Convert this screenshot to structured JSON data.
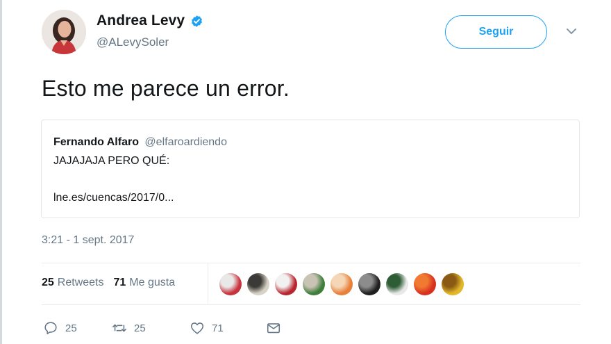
{
  "author": {
    "name": "Andrea Levy",
    "handle": "@ALevySoler",
    "verified": true
  },
  "follow_button": {
    "label": "Seguir"
  },
  "tweet": {
    "text": "Esto me parece un error.",
    "timestamp": "3:21 - 1 sept. 2017"
  },
  "quoted_tweet": {
    "name": "Fernando Alfaro",
    "handle": "@elfaroardiendo",
    "text": "JAJAJAJA PERO QUÉ:",
    "link": "lne.es/cuencas/2017/0..."
  },
  "stats": {
    "retweets_count": "25",
    "retweets_label": "Retweets",
    "likes_count": "71",
    "likes_label": "Me gusta"
  },
  "actions": {
    "reply_count": "25",
    "retweet_count": "25",
    "like_count": "71"
  },
  "colors": {
    "accent": "#1da1f2",
    "secondary_text": "#657786",
    "border": "#e1e8ed"
  },
  "likers": [
    {
      "icon": "liker-avatar",
      "colors": [
        "#c8333b",
        "#e8e8e8"
      ]
    },
    {
      "icon": "liker-avatar",
      "colors": [
        "#d8d2c6",
        "#3b3a36"
      ]
    },
    {
      "icon": "liker-avatar",
      "colors": [
        "#b9252f",
        "#f1f1f1"
      ]
    },
    {
      "icon": "liker-avatar",
      "colors": [
        "#3f7d3a",
        "#c9c3b6"
      ]
    },
    {
      "icon": "liker-avatar",
      "colors": [
        "#e8803a",
        "#f5d6b6"
      ]
    },
    {
      "icon": "liker-avatar",
      "colors": [
        "#1f1f1f",
        "#8c8c8c"
      ]
    },
    {
      "icon": "liker-avatar",
      "colors": [
        "#e8e8e8",
        "#2d5d35"
      ]
    },
    {
      "icon": "liker-avatar",
      "colors": [
        "#d8301f",
        "#f07a32"
      ]
    },
    {
      "icon": "liker-avatar",
      "colors": [
        "#e3b72a",
        "#8a5a14"
      ]
    }
  ]
}
